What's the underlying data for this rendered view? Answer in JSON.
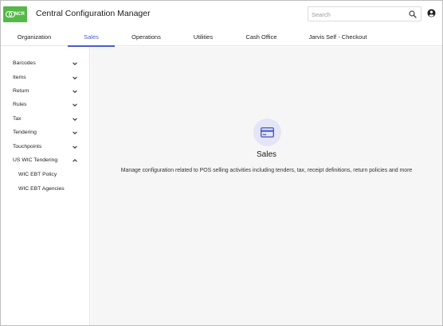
{
  "header": {
    "logo_text": "NCR",
    "title": "Central Configuration Manager",
    "search_placeholder": "Search",
    "search_value": "",
    "search_icon": "search-icon",
    "account_icon": "account-circle-icon"
  },
  "tabs": [
    {
      "label": "Organization",
      "active": false
    },
    {
      "label": "Sales",
      "active": true
    },
    {
      "label": "Operations",
      "active": false
    },
    {
      "label": "Utilities",
      "active": false
    },
    {
      "label": "Cash Office",
      "active": false
    },
    {
      "label": "Jarvis Self - Checkout",
      "active": false
    }
  ],
  "sidebar": {
    "items": [
      {
        "label": "Barcodes",
        "expanded": false
      },
      {
        "label": "Items",
        "expanded": false
      },
      {
        "label": "Return",
        "expanded": false
      },
      {
        "label": "Rules",
        "expanded": false
      },
      {
        "label": "Tax",
        "expanded": false
      },
      {
        "label": "Tendering",
        "expanded": false
      },
      {
        "label": "Touchpoints",
        "expanded": false
      },
      {
        "label": "US WIC Tendering",
        "expanded": true
      }
    ],
    "subitems": [
      {
        "label": "WIC EBT Policy"
      },
      {
        "label": "WIC EBT Agencies"
      }
    ]
  },
  "main": {
    "icon": "credit-card-icon",
    "title": "Sales",
    "description": "Manage configuration related to POS selling activities including tenders, tax, receipt definitions, return policies and more"
  },
  "colors": {
    "accent": "#4a5cc8",
    "logo_green": "#54b948",
    "icon_circle": "#e4e6f7",
    "main_bg": "#f6f6f6"
  }
}
